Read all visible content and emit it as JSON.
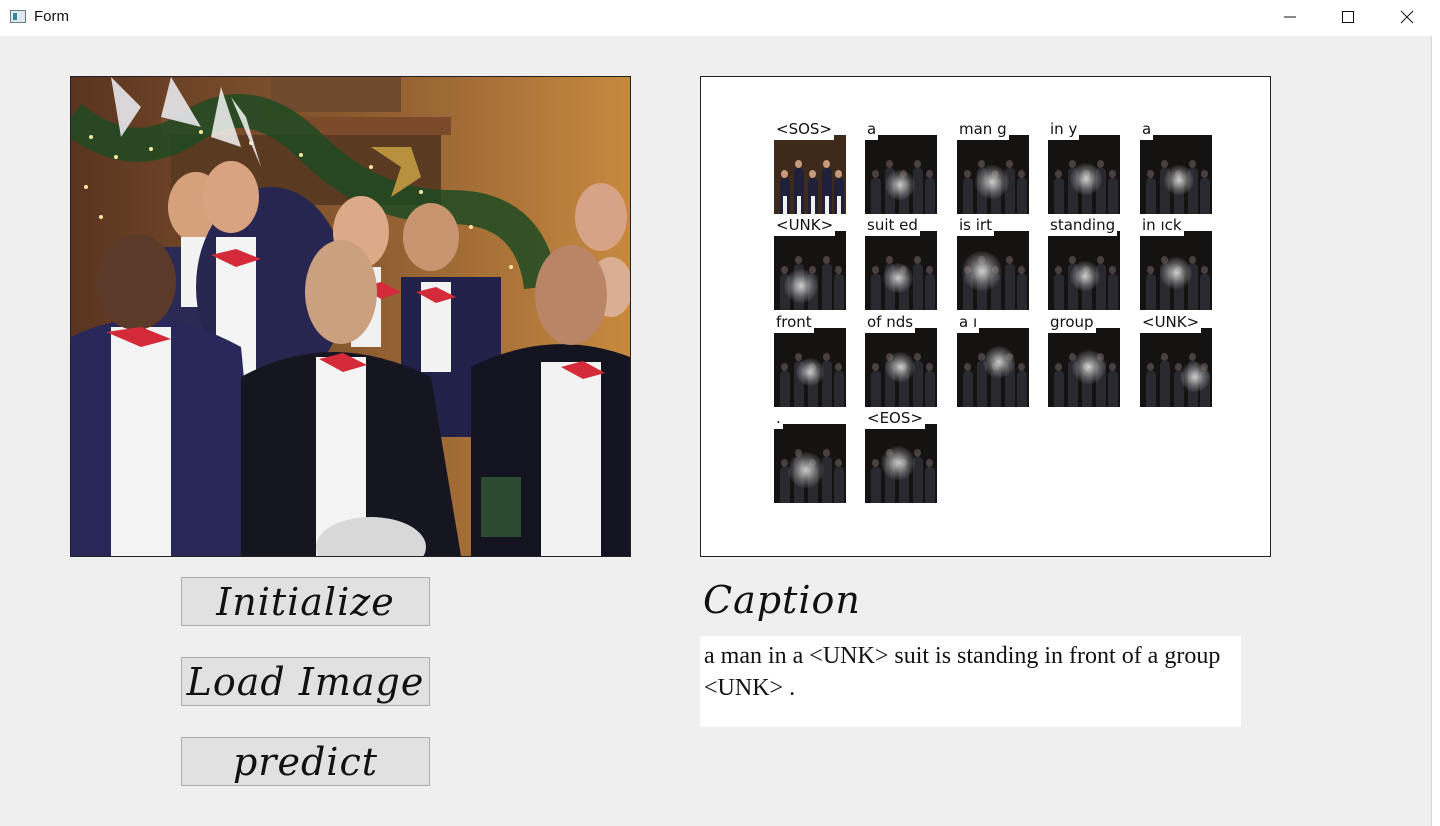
{
  "window": {
    "title": "Form",
    "minimize_icon": "minimize-icon",
    "maximize_icon": "maximize-icon",
    "close_icon": "close-icon"
  },
  "photo": {
    "description_icon": "choir-photo"
  },
  "attention": {
    "cells": [
      {
        "word": "<SOS>",
        "color": true
      },
      {
        "word": "a"
      },
      {
        "word": "man g"
      },
      {
        "word": "in y"
      },
      {
        "word": "a"
      },
      {
        "word": "<UNK>"
      },
      {
        "word": "suit ed"
      },
      {
        "word": "is irt"
      },
      {
        "word": "standing"
      },
      {
        "word": "in ıck"
      },
      {
        "word": "front"
      },
      {
        "word": "of nds"
      },
      {
        "word": "a ı"
      },
      {
        "word": "group"
      },
      {
        "word": "<UNK>"
      },
      {
        "word": "."
      },
      {
        "word": "<EOS>"
      }
    ]
  },
  "buttons": {
    "initialize": "Initialize",
    "load_image": "Load Image",
    "predict": "predict"
  },
  "caption": {
    "label": "Caption",
    "text": "a man in a <UNK> suit is standing in front of a group <UNK> ."
  }
}
